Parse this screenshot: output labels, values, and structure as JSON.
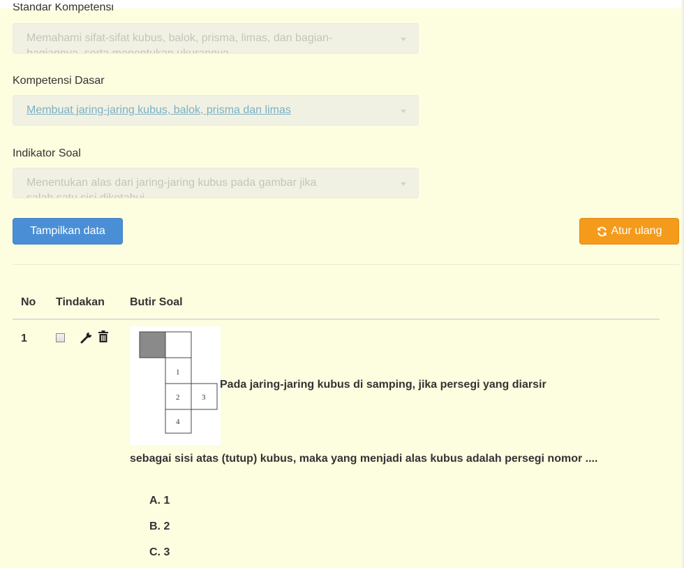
{
  "form": {
    "standar_kompetensi": {
      "label": "Standar Kompetensi",
      "value": "Memahami sifat-sifat kubus, balok, prisma, limas, dan bagian-",
      "value_line2": "bagiannya, serta menentukan ukurannya"
    },
    "kompetensi_dasar": {
      "label": "Kompetensi Dasar",
      "value": "Membuat jaring-jaring kubus, balok, prisma dan limas"
    },
    "indikator_soal": {
      "label": "Indikator Soal",
      "value": "Menentukan alas dari jaring-jaring kubus pada gambar jika",
      "value_line2": "salah satu sisi diketahui"
    }
  },
  "buttons": {
    "show": "Tampilkan data",
    "reset": "Atur ulang"
  },
  "table": {
    "headers": [
      "No",
      "Tindakan",
      "Butir Soal"
    ],
    "rows": [
      {
        "no": "1",
        "question_part1": "Pada jaring-jaring kubus di samping, jika persegi yang diarsir",
        "question_part2": "sebagai sisi atas (tutup) kubus, maka yang menjadi alas kubus adalah persegi nomor ....",
        "figure_labels": [
          "1",
          "2",
          "3",
          "4"
        ],
        "options": [
          "A.  1",
          "B.  2",
          "C.  3"
        ]
      }
    ]
  },
  "colors": {
    "background": "#fdfde0",
    "primary": "#4a8fd6",
    "warning": "#f49b1c"
  },
  "icons": [
    "caret-down-icon",
    "refresh-icon",
    "wrench-icon",
    "trash-icon"
  ]
}
